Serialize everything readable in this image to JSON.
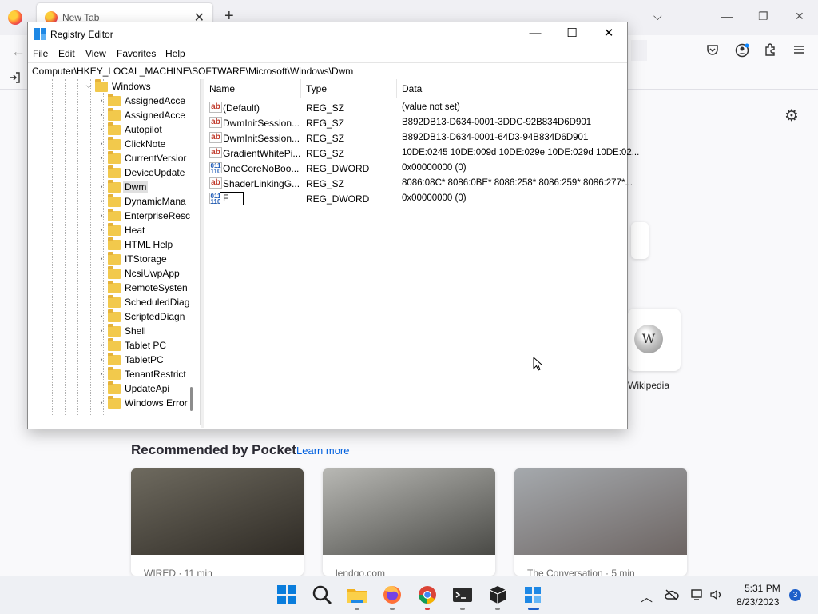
{
  "browser": {
    "tab_title": "New Tab",
    "tab_close": "✕",
    "new_tab": "+",
    "list_all_tabs": "⌵",
    "win_minimize": "—",
    "win_restore": "❐",
    "win_close": "✕",
    "back": "←",
    "gear": "⚙",
    "shortcut_label": "Wikipedia",
    "pocket_title": "Recommended by Pocket",
    "pocket_learn_more": "Learn more",
    "pocket_cards": [
      {
        "source": "WIRED · 11 min",
        "color_top": "#6e6a5f",
        "color_bottom": "#2f2b25"
      },
      {
        "source": "lendgo.com",
        "color_top": "#b8b8b4",
        "color_bottom": "#4a4a46"
      },
      {
        "source": "The Conversation · 5 min",
        "color_top": "#a5a9ad",
        "color_bottom": "#6d6563"
      }
    ]
  },
  "regedit": {
    "title": "Registry Editor",
    "btn_minimize": "—",
    "btn_maximize": "☐",
    "btn_close": "✕",
    "menu": [
      "File",
      "Edit",
      "View",
      "Favorites",
      "Help"
    ],
    "address": "Computer\\HKEY_LOCAL_MACHINE\\SOFTWARE\\Microsoft\\Windows\\Dwm",
    "tree": {
      "parent": "Windows",
      "children": [
        {
          "label": "AssignedAcce",
          "arrow": "›"
        },
        {
          "label": "AssignedAcce",
          "arrow": "›"
        },
        {
          "label": "Autopilot",
          "arrow": "›"
        },
        {
          "label": "ClickNote",
          "arrow": "›"
        },
        {
          "label": "CurrentVersior",
          "arrow": "›"
        },
        {
          "label": "DeviceUpdate​",
          "arrow": ""
        },
        {
          "label": "Dwm",
          "arrow": "›",
          "selected": true
        },
        {
          "label": "DynamicMana",
          "arrow": "›"
        },
        {
          "label": "EnterpriseResc",
          "arrow": "›"
        },
        {
          "label": "Heat",
          "arrow": "›"
        },
        {
          "label": "HTML Help",
          "arrow": ""
        },
        {
          "label": "ITStorage",
          "arrow": "›"
        },
        {
          "label": "NcsiUwpApp",
          "arrow": ""
        },
        {
          "label": "RemoteSysten",
          "arrow": ""
        },
        {
          "label": "ScheduledDiag",
          "arrow": ""
        },
        {
          "label": "ScriptedDiagn",
          "arrow": "›"
        },
        {
          "label": "Shell",
          "arrow": "›"
        },
        {
          "label": "Tablet PC",
          "arrow": "›"
        },
        {
          "label": "TabletPC",
          "arrow": "›"
        },
        {
          "label": "TenantRestrict",
          "arrow": "›"
        },
        {
          "label": "UpdateApi",
          "arrow": ""
        },
        {
          "label": "Windows Error",
          "arrow": "›"
        }
      ]
    },
    "columns": {
      "name": "Name",
      "type": "Type",
      "data": "Data"
    },
    "values": [
      {
        "icon": "sz",
        "name": "(Default)",
        "type": "REG_SZ",
        "data": "(value not set)"
      },
      {
        "icon": "sz",
        "name": "DwmInitSession...",
        "type": "REG_SZ",
        "data": "B892DB13-D634-0001-3DDC-92B834D6D901"
      },
      {
        "icon": "sz",
        "name": "DwmInitSession...",
        "type": "REG_SZ",
        "data": "B892DB13-D634-0001-64D3-94B834D6D901"
      },
      {
        "icon": "sz",
        "name": "GradientWhitePi...",
        "type": "REG_SZ",
        "data": "10DE:0245 10DE:009d 10DE:029e 10DE:029d 10DE:02..."
      },
      {
        "icon": "dw",
        "name": "OneCoreNoBoo...",
        "type": "REG_DWORD",
        "data": "0x00000000 (0)"
      },
      {
        "icon": "sz",
        "name": "ShaderLinkingG...",
        "type": "REG_SZ",
        "data": "8086:08C* 8086:0BE* 8086:258* 8086:259* 8086:277*..."
      },
      {
        "icon": "dw",
        "name": "F",
        "type": "REG_DWORD",
        "data": "0x00000000 (0)",
        "editing": true
      }
    ]
  },
  "taskbar": {
    "time": "5:31 PM",
    "date": "8/23/2023",
    "notifications": "3",
    "tray_chevron": "︿",
    "apps": [
      "start-icon",
      "search-icon",
      "file-explorer-icon",
      "firefox-icon",
      "chrome-icon",
      "terminal-icon",
      "package-icon",
      "regedit-icon"
    ]
  },
  "colors": {
    "accent": "#1e5bb8",
    "link": "#0060df",
    "folder": "#f2c94c",
    "win_blue": "#1e88e5"
  }
}
